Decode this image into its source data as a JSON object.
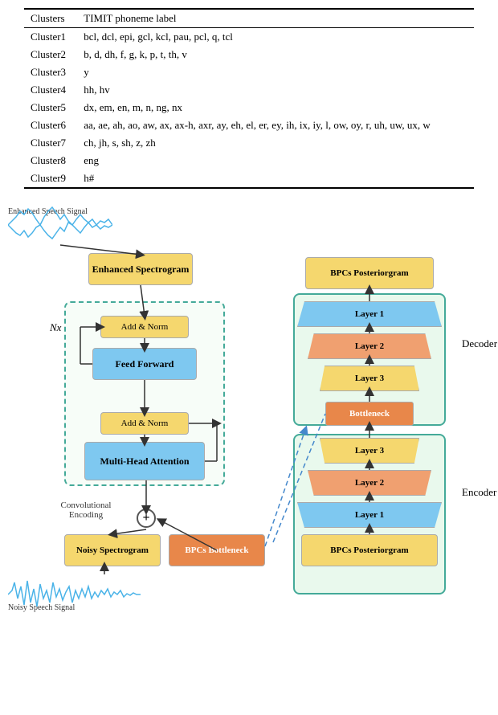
{
  "table": {
    "headers": [
      "Clusters",
      "TIMIT phoneme label"
    ],
    "rows": [
      {
        "cluster": "Cluster1",
        "phonemes": "bcl, dcl, epi, gcl, kcl, pau, pcl, q, tcl"
      },
      {
        "cluster": "Cluster2",
        "phonemes": "b, d, dh, f, g, k, p, t, th, v"
      },
      {
        "cluster": "Cluster3",
        "phonemes": "y"
      },
      {
        "cluster": "Cluster4",
        "phonemes": "hh, hv"
      },
      {
        "cluster": "Cluster5",
        "phonemes": "dx, em, en, m, n, ng, nx"
      },
      {
        "cluster": "Cluster6",
        "phonemes": "aa, ae, ah, ao, aw, ax, ax-h, axr, ay, eh, el, er, ey, ih, ix, iy, l, ow, oy, r, uh, uw, ux, w"
      },
      {
        "cluster": "Cluster7",
        "phonemes": "ch, jh, s, sh, z, zh"
      },
      {
        "cluster": "Cluster8",
        "phonemes": "eng"
      },
      {
        "cluster": "Cluster9",
        "phonemes": "h#"
      }
    ]
  },
  "diagram": {
    "nx_label": "Nx",
    "enhanced_spectrogram": "Enhanced\nSpectrogram",
    "add_norm_1": "Add & Norm",
    "add_norm_2": "Add & Norm",
    "feed_forward": "Feed Forward",
    "multi_head_attention": "Multi-Head\nAttention",
    "conv_encoding": "Convolutional\nEncoding",
    "plus": "+",
    "noisy_spectrogram": "Noisy\nSpectrogram",
    "bpcs_bottleneck_left": "BPCs\nBottleneck",
    "bpcs_posteriorgram_top": "BPCs\nPosteriorgram",
    "bpcs_posteriorgram_bottom": "BPCs\nPosteriorgram",
    "bottleneck": "Bottleneck",
    "decoder_label": "Decoder",
    "encoder_label": "Encoder",
    "dec_layer1": "Layer 1",
    "dec_layer2": "Layer 2",
    "dec_layer3": "Layer 3",
    "enc_layer1": "Layer 1",
    "enc_layer2": "Layer 2",
    "enc_layer3": "Layer 3",
    "enhanced_speech_label": "Enhanced\nSpeech Signal",
    "noisy_speech_label": "Noisy\nSpeech Signal"
  }
}
